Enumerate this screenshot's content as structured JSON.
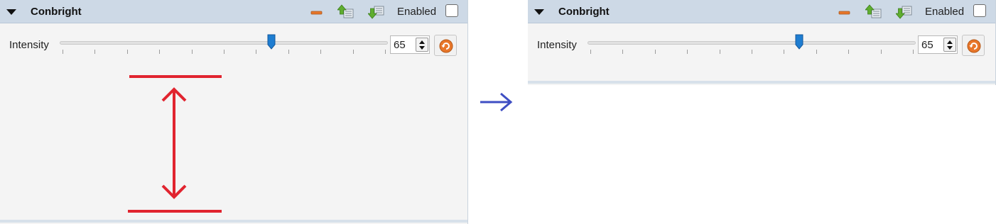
{
  "colors": {
    "header_bg": "#cdd9e6",
    "panel_bg": "#f4f4f4",
    "slider_handle": "#1e7dd1",
    "annotation_red": "#e1242f",
    "transition_arrow": "#3e4ec3",
    "reset_orange": "#e8762a"
  },
  "before": {
    "module": {
      "title": "Conbright",
      "enabled_label": "Enabled",
      "enabled_checked": false,
      "icons": [
        "collapse-arrow-icon",
        "minimize-icon",
        "move-up-icon",
        "move-down-icon",
        "reset-icon"
      ]
    },
    "control": {
      "label": "Intensity",
      "value": "65",
      "slider_fraction": 0.645
    }
  },
  "after": {
    "module": {
      "title": "Conbright",
      "enabled_label": "Enabled",
      "enabled_checked": false
    },
    "control": {
      "label": "Intensity",
      "value": "65",
      "slider_fraction": 0.645
    }
  }
}
